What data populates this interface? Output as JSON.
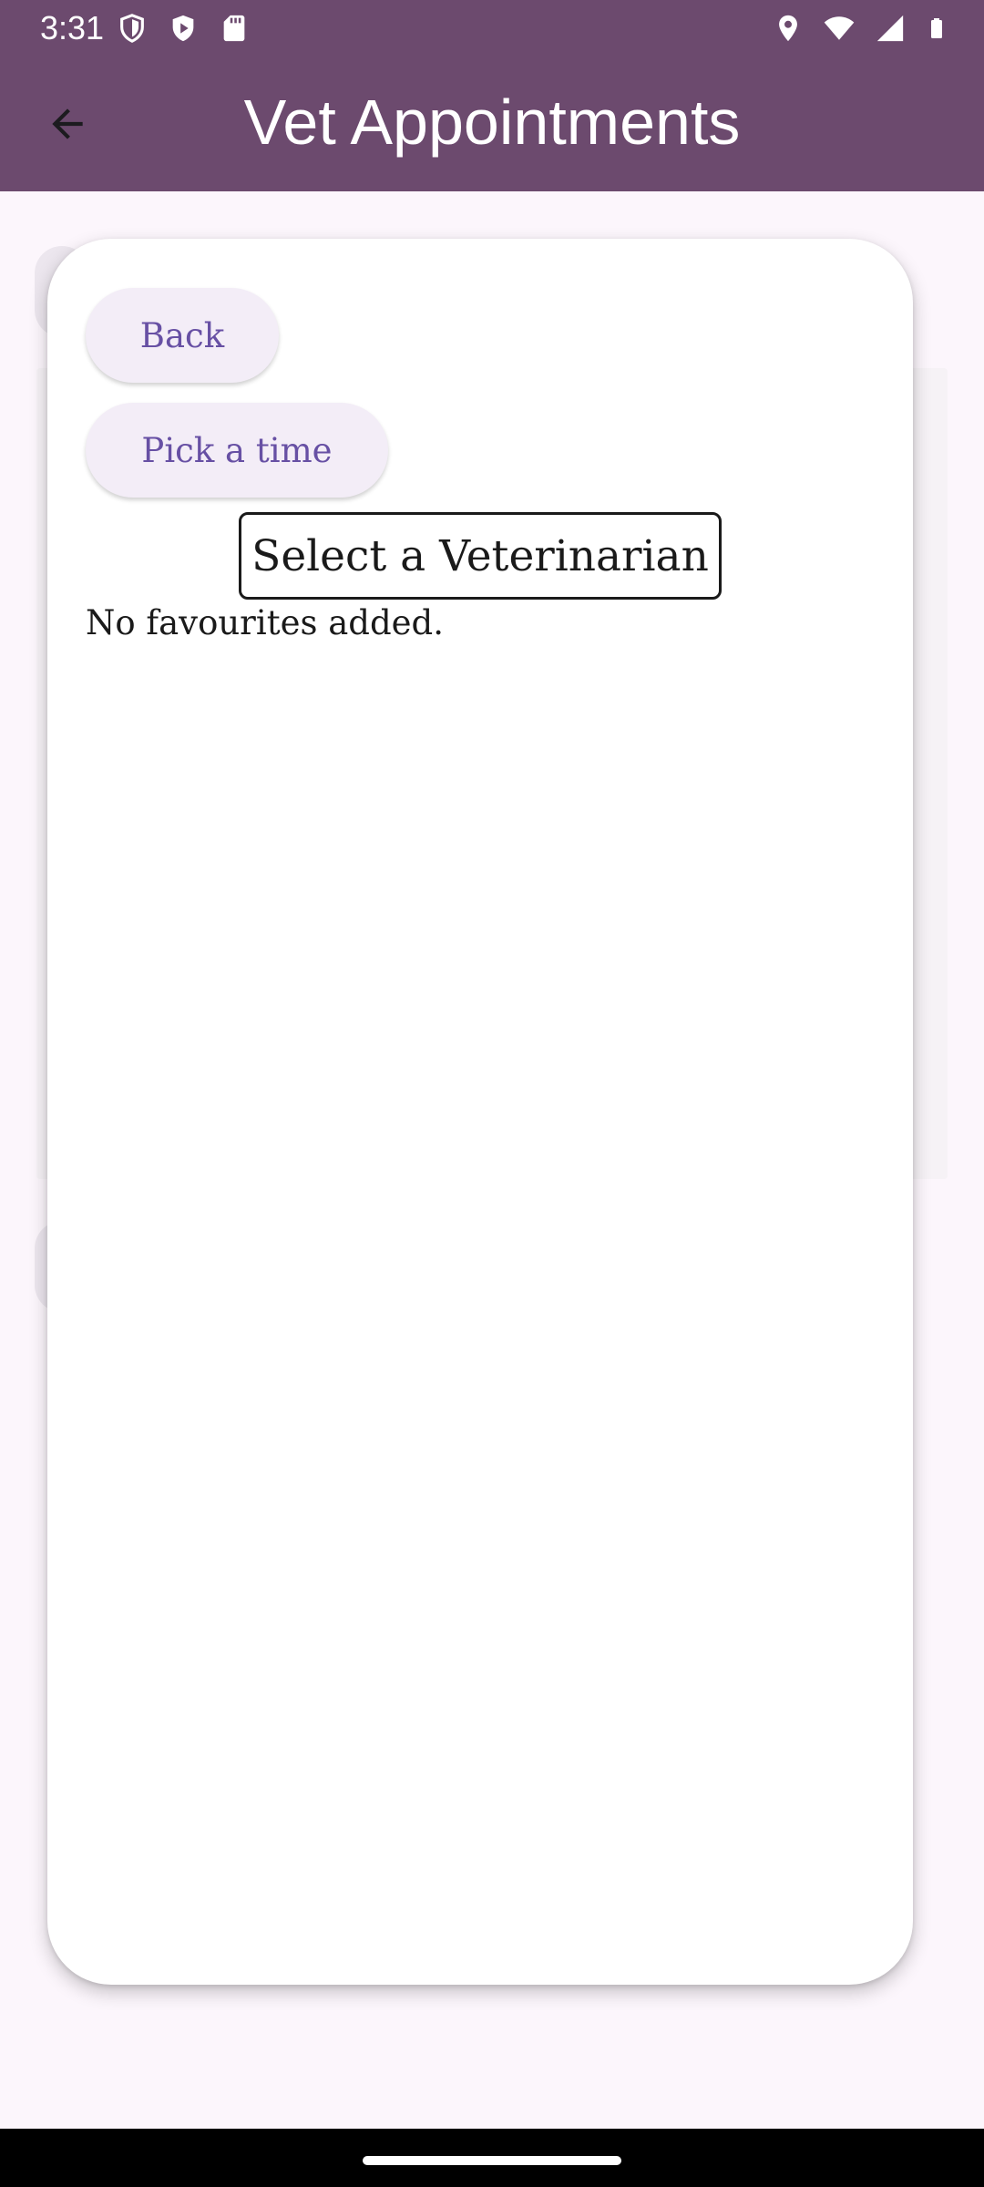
{
  "status_bar": {
    "time": "3:31",
    "left_icons": [
      "shield-icon",
      "play-protect-icon",
      "sd-card-icon"
    ],
    "right_icons": [
      "location-icon",
      "wifi-icon",
      "cellular-signal-icon",
      "battery-icon"
    ]
  },
  "app_bar": {
    "title": "Vet Appointments",
    "back_icon": "arrow-back-icon"
  },
  "dialog": {
    "back_label": "Back",
    "pick_time_label": "Pick a time",
    "section_title": "Select a Veterinarian",
    "empty_message": "No favourites added."
  },
  "colors": {
    "app_bar": "#6C4A6E",
    "page_background": "#FCF6FC",
    "button_background": "#F3EDF7",
    "button_text": "#6750A4"
  }
}
